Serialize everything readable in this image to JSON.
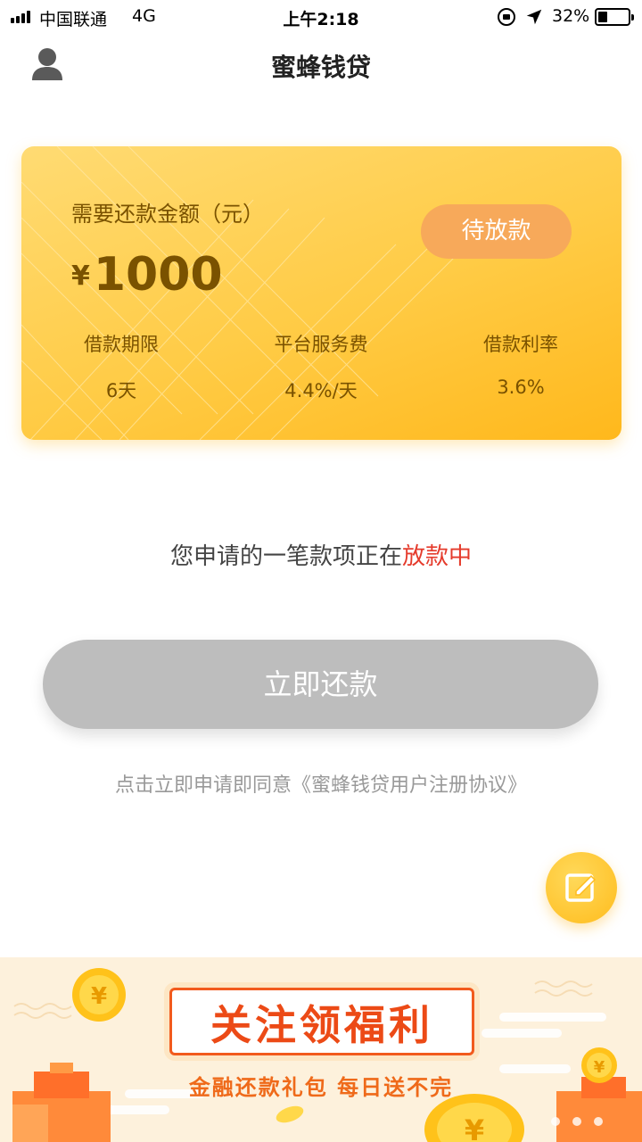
{
  "status_bar": {
    "carrier": "中国联通",
    "network": "4G",
    "time": "上午2:18",
    "battery_percent": "32%",
    "battery_level": 0.32,
    "icons": [
      "signal-icon",
      "orientation-lock-icon",
      "location-arrow-icon",
      "battery-icon"
    ]
  },
  "nav": {
    "title": "蜜蜂钱贷",
    "left_icon": "user-icon"
  },
  "loan_card": {
    "amount_label": "需要还款金额（元）",
    "currency": "¥",
    "amount": "1000",
    "status_button": "待放款",
    "stats": [
      {
        "label": "借款期限",
        "value": "6天"
      },
      {
        "label": "平台服务费",
        "value": "4.4%/天"
      },
      {
        "label": "借款利率",
        "value": "3.6%"
      }
    ]
  },
  "message": {
    "prefix": "您申请的一笔款项正在",
    "highlight": "放款中"
  },
  "repay_button": "立即还款",
  "agreement": "点击立即申请即同意《蜜蜂钱贷用户注册协议》",
  "fab_icon": "edit-icon",
  "banner": {
    "headline": "关注领福利",
    "subline": "金融还款礼包 每日送不完",
    "coin_symbol": "¥"
  },
  "colors": {
    "card_gradient_start": "#ffdb73",
    "card_gradient_end": "#ffb81c",
    "status_button": "#f7a95a",
    "highlight_red": "#e53b2c",
    "button_disabled": "#bdbdbd",
    "banner_red": "#ec4a16"
  }
}
